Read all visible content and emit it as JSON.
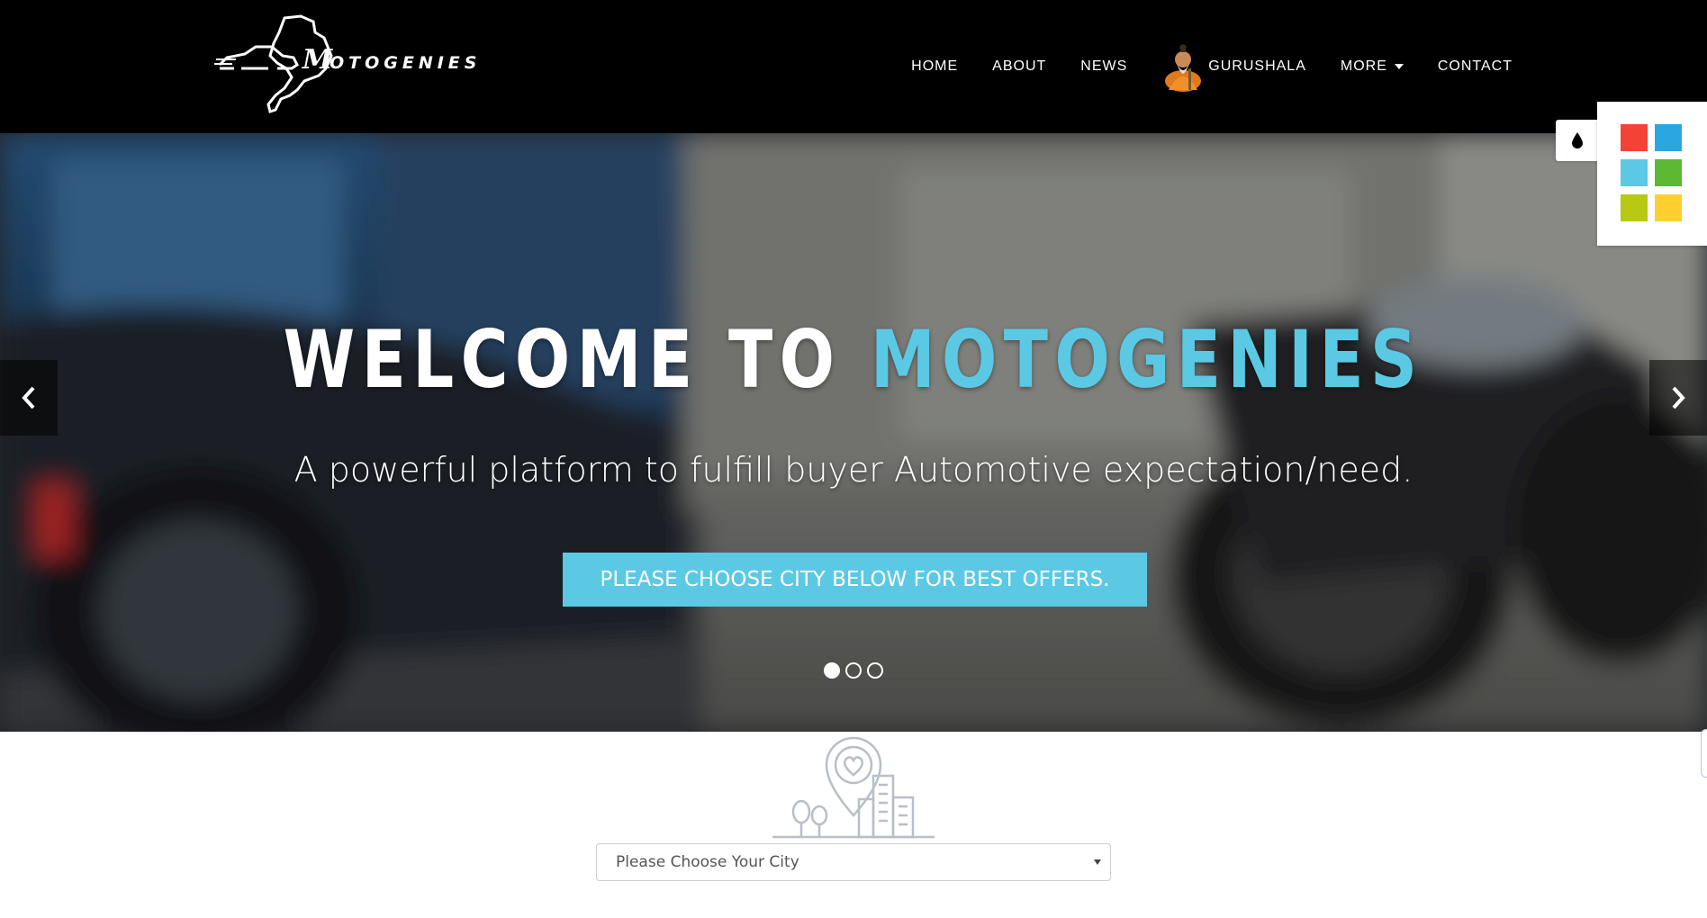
{
  "brand": {
    "logo_text": "MOTOGENIES"
  },
  "nav": {
    "items": [
      {
        "label": "HOME"
      },
      {
        "label": "ABOUT"
      },
      {
        "label": "NEWS"
      },
      {
        "label": "GURUSHALA",
        "icon": "sage-avatar-icon"
      },
      {
        "label": "MORE",
        "icon": "caret-down-icon"
      },
      {
        "label": "CONTACT"
      }
    ]
  },
  "hero": {
    "title_prefix": "WELCOME TO",
    "title_accent": "MOTOGENIES",
    "subtitle": "A powerful platform to fulfill buyer Automotive expectation/need.",
    "cta_label": "PLEASE CHOOSE CITY BELOW FOR BEST OFFERS.",
    "slides_total": 3,
    "active_slide": 1,
    "accent_color": "#5bc9e4"
  },
  "color_switcher": {
    "icon": "drop-icon",
    "swatches": [
      "#f44336",
      "#29a8e0",
      "#5bc9e4",
      "#5cb832",
      "#b6c913",
      "#fdd02f"
    ]
  },
  "city": {
    "icon": "city-location-icon",
    "select_placeholder": "Please Choose Your City"
  }
}
